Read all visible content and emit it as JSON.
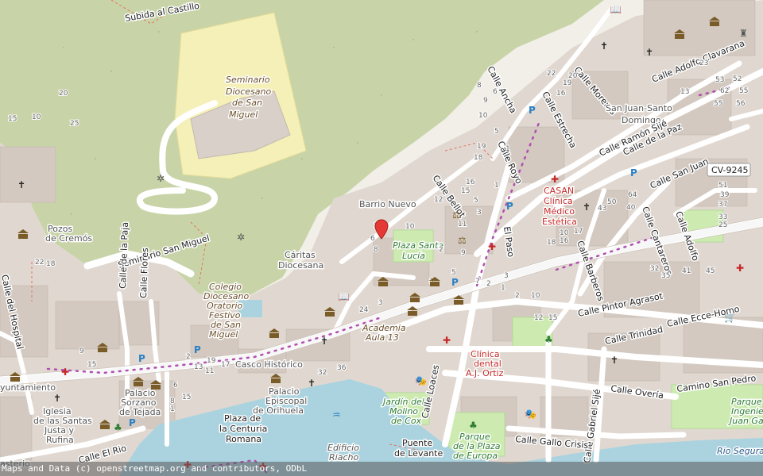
{
  "attribution": "Maps and Data (c) openstreetmap.org and contributors, ODbL",
  "colors": {
    "background": "#f2efe9",
    "hill": "#c8d4a8",
    "building": "#d9d0c9",
    "road": "#ffffff",
    "water": "#aad3df",
    "park": "#cdebb0",
    "seminario": "#f5f0b8"
  },
  "labels": {
    "subida_castillo": "Subida al Castillo",
    "seminario": "Seminario",
    "diocesano": "Diocesano",
    "de_san": "de San",
    "miguel": "Miguel",
    "pozos": "Pozos",
    "de_cremos": "de Cremós",
    "seminario_san_miguel": "Seminario San Miguel",
    "colegio1": "Colegio",
    "colegio2": "Diocesano",
    "colegio3": "Oratorio",
    "colegio4": "Festivo",
    "colegio5": "de San",
    "colegio6": "Miguel",
    "caritas1": "Cáritas",
    "caritas2": "Diocesana",
    "barrio_nuevo": "Barrio Nuevo",
    "plaza_santa_lucia1": "Plaza Santa",
    "plaza_santa_lucia2": "Lucía",
    "calle_bellot": "Calle Bellot",
    "calle_royo": "Calle Royo",
    "calle_ancha": "Calle Ancha",
    "calle_estrecha": "Calle Estrecha",
    "calle_moreras": "Calle Moreras",
    "san_juan_santo1": "San Juan-Santo",
    "san_juan_santo2": "Domingo",
    "calle_adolfo_clavarana": "Calle Adolfo Clavarana",
    "calle_ramon_sije": "Calle Ramón Sijé",
    "calle_de_la_paz": "Calle de la Paz",
    "calle_san_juan": "Calle San Juan",
    "cv9245": "CV-9245",
    "casan1": "CASAN",
    "casan2": "Clínica",
    "casan3": "Médico",
    "casan4": "Estética",
    "calle_cantareros": "Calle Cantareros",
    "calle_adolfo": "Calle Adolfo",
    "calle_barberos": "Calle Barberos",
    "el_paso": "El Paso",
    "calle_pintor_agrasot": "Calle Pintor Agrasot",
    "calle_ecce_homo": "Calle Ecce-Homo",
    "calle_trinidad": "Calle Trinidad",
    "academia1": "Academia",
    "academia2": "Aula 13",
    "casco_historico": "Casco Histórico",
    "calle_del_hospital": "Calle del Hospital",
    "calle_de_la_paja": "Calle de la Paja",
    "calle_flores": "Calle Flores",
    "ayuntamiento": "yuntamiento",
    "palacio_sorzano1": "Palacio",
    "palacio_sorzano2": "Sorzano",
    "palacio_sorzano3": "de Tejada",
    "palacio_episcopal1": "Palacio",
    "palacio_episcopal2": "Episcopal",
    "palacio_episcopal3": "de Orihuela",
    "iglesia1": "Iglesia",
    "iglesia2": "de las Santas",
    "iglesia3": "Justa y",
    "iglesia4": "Rufina",
    "plaza_centuria1": "Plaza de",
    "plaza_centuria2": "la Centuria",
    "plaza_centuria3": "Romana",
    "calle_el_rio": "Calle El Rio",
    "jardin1": "Jardín del",
    "jardin2": "Molino",
    "jardin3": "de Cox",
    "calle_loaces": "Calle Loaces",
    "clinica_dental1": "Clínica",
    "clinica_dental2": "dental",
    "clinica_dental3": "A.J. Ortiz",
    "calle_overia": "Calle Overía",
    "camino_san_pedro": "Camino San Pedro",
    "calle_gabriel_sije": "Calle Gabriel Sijé",
    "calle_gallo_crisis": "Calle Gallo Crisis",
    "parque1": "Parque",
    "parque2": "de la Plaza",
    "parque3": "de Europa",
    "puente1": "Puente",
    "puente2": "de Levante",
    "edificio1": "Edificio",
    "edificio2": "Riacho",
    "rio_segura": "Rio Segura",
    "parque_ingeniero1": "Parque",
    "parque_ingeniero2": "Ingenier",
    "parque_ingeniero3": "Juan Gar",
    "asterio": "asterio"
  },
  "house_numbers": [
    "25",
    "15",
    "10",
    "20",
    "22",
    "18",
    "9",
    "15",
    "19",
    "17",
    "13",
    "11",
    "6",
    "8",
    "15",
    "1",
    "2",
    "24",
    "3",
    "32",
    "36",
    "1",
    "6",
    "8",
    "10",
    "12",
    "15",
    "16",
    "18",
    "19",
    "10",
    "9",
    "6",
    "1",
    "3",
    "5",
    "11",
    "9",
    "3",
    "5",
    "2",
    "7",
    "2",
    "3",
    "1",
    "2",
    "10",
    "12",
    "15",
    "18",
    "10",
    "16",
    "17",
    "64",
    "40",
    "43",
    "50",
    "32",
    "35",
    "41",
    "45",
    "51",
    "39",
    "37",
    "33",
    "25",
    "23",
    "52",
    "55",
    "56",
    "53",
    "62",
    "55",
    "13",
    "16",
    "19",
    "20",
    "22",
    "8",
    "1",
    "5"
  ],
  "route_labels": {
    "dot_count": "many"
  },
  "marker": {
    "name": "location-pin",
    "color": "#e53935"
  }
}
